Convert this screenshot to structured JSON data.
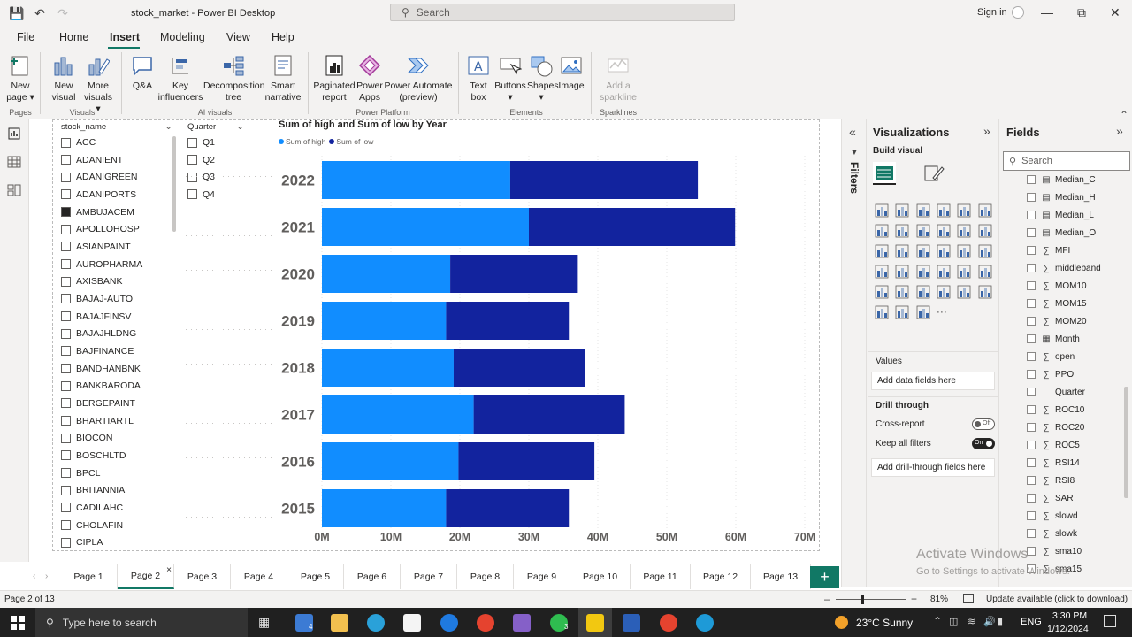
{
  "app": {
    "title": "stock_market - Power BI Desktop",
    "search_placeholder": "Search",
    "signin": "Sign in"
  },
  "menu": [
    "File",
    "Home",
    "Insert",
    "Modeling",
    "View",
    "Help"
  ],
  "ribbon": {
    "pages_group": "Pages",
    "visuals_group": "Visuals",
    "ai_group": "AI visuals",
    "pp_group": "Power Platform",
    "elements_group": "Elements",
    "sparklines_group": "Sparklines",
    "new_page": [
      "New",
      "page ▾"
    ],
    "new_visual": [
      "New",
      "visual"
    ],
    "more_visuals": [
      "More",
      "visuals ▾"
    ],
    "qa": [
      "Q&A",
      ""
    ],
    "key_influencers": [
      "Key",
      "influencers"
    ],
    "decomposition": [
      "Decomposition",
      "tree"
    ],
    "smart_narrative": [
      "Smart",
      "narrative"
    ],
    "paginated": [
      "Paginated",
      "report"
    ],
    "power_apps": [
      "Power",
      "Apps"
    ],
    "power_automate": [
      "Power Automate",
      "(preview)"
    ],
    "text_box": [
      "Text",
      "box"
    ],
    "buttons": [
      "Buttons",
      "▾"
    ],
    "shapes": [
      "Shapes",
      "▾"
    ],
    "image": [
      "Image",
      ""
    ],
    "sparkline": [
      "Add a",
      "sparkline"
    ]
  },
  "slicer_stock": {
    "header": "stock_name",
    "items": [
      "ACC",
      "ADANIENT",
      "ADANIGREEN",
      "ADANIPORTS",
      "AMBUJACEM",
      "APOLLOHOSP",
      "ASIANPAINT",
      "AUROPHARMA",
      "AXISBANK",
      "BAJAJ-AUTO",
      "BAJAJFINSV",
      "BAJAJHLDNG",
      "BAJFINANCE",
      "BANDHANBNK",
      "BANKBARODA",
      "BERGEPAINT",
      "BHARTIARTL",
      "BIOCON",
      "BOSCHLTD",
      "BPCL",
      "BRITANNIA",
      "CADILAHC",
      "CHOLAFIN",
      "CIPLA"
    ],
    "checked_index": 4
  },
  "slicer_quarter": {
    "header": "Quarter",
    "items": [
      "Q1",
      "Q2",
      "Q3",
      "Q4"
    ]
  },
  "chart_data": {
    "type": "bar",
    "title": "Sum of high and Sum of low by Year",
    "categories": [
      "2022",
      "2021",
      "2020",
      "2019",
      "2018",
      "2017",
      "2016",
      "2015"
    ],
    "series": [
      {
        "name": "Sum of high",
        "color": "#118DFF",
        "values": [
          27.3,
          30.0,
          18.6,
          18.0,
          19.1,
          22.0,
          19.8,
          18.0
        ]
      },
      {
        "name": "Sum of low",
        "color": "#12239E",
        "values": [
          27.2,
          29.9,
          18.5,
          17.8,
          19.0,
          21.9,
          19.7,
          17.8
        ]
      }
    ],
    "stacked": true,
    "xticks": [
      "0M",
      "10M",
      "20M",
      "30M",
      "40M",
      "50M",
      "60M",
      "70M"
    ],
    "xlim": [
      0,
      70
    ],
    "legend": "top-left"
  },
  "viz_pane": {
    "title": "Visualizations",
    "build_visual": "Build visual",
    "filters": "Filters",
    "values_label": "Values",
    "values_placeholder": "Add data fields here",
    "drill_through": "Drill through",
    "cross_report": "Cross-report",
    "cross_report_state": "Off",
    "keep_filters": "Keep all filters",
    "keep_filters_state": "On",
    "drill_placeholder": "Add drill-through fields here"
  },
  "fields_pane": {
    "title": "Fields",
    "search_placeholder": "Search",
    "fields": [
      {
        "name": "Median_C",
        "icon": "calc"
      },
      {
        "name": "Median_H",
        "icon": "calc"
      },
      {
        "name": "Median_L",
        "icon": "calc"
      },
      {
        "name": "Median_O",
        "icon": "calc"
      },
      {
        "name": "MFI",
        "icon": "sigma"
      },
      {
        "name": "middleband",
        "icon": "sigma"
      },
      {
        "name": "MOM10",
        "icon": "sigma"
      },
      {
        "name": "MOM15",
        "icon": "sigma"
      },
      {
        "name": "MOM20",
        "icon": "sigma"
      },
      {
        "name": "Month",
        "icon": "table"
      },
      {
        "name": "open",
        "icon": "sigma"
      },
      {
        "name": "PPO",
        "icon": "sigma"
      },
      {
        "name": "Quarter",
        "icon": "none"
      },
      {
        "name": "ROC10",
        "icon": "sigma"
      },
      {
        "name": "ROC20",
        "icon": "sigma"
      },
      {
        "name": "ROC5",
        "icon": "sigma"
      },
      {
        "name": "RSI14",
        "icon": "sigma"
      },
      {
        "name": "RSI8",
        "icon": "sigma"
      },
      {
        "name": "SAR",
        "icon": "sigma"
      },
      {
        "name": "slowd",
        "icon": "sigma"
      },
      {
        "name": "slowk",
        "icon": "sigma"
      },
      {
        "name": "sma10",
        "icon": "sigma"
      },
      {
        "name": "sma15",
        "icon": "sigma"
      }
    ]
  },
  "page_tabs": [
    "Page 1",
    "Page 2",
    "Page 3",
    "Page 4",
    "Page 5",
    "Page 6",
    "Page 7",
    "Page 8",
    "Page 9",
    "Page 10",
    "Page 11",
    "Page 12",
    "Page 13"
  ],
  "active_tab": 1,
  "status": {
    "page": "Page 2 of 13",
    "zoom": "81%",
    "update": "Update available (click to download)"
  },
  "watermark": {
    "line1": "Activate Windows",
    "line2": "Go to Settings to activate Windows."
  },
  "taskbar": {
    "search": "Type here to search",
    "weather": "23°C  Sunny",
    "lang": "ENG",
    "time": "3:30 PM",
    "date": "1/12/2024",
    "mail_badge": "4",
    "whatsapp_badge": "3"
  }
}
